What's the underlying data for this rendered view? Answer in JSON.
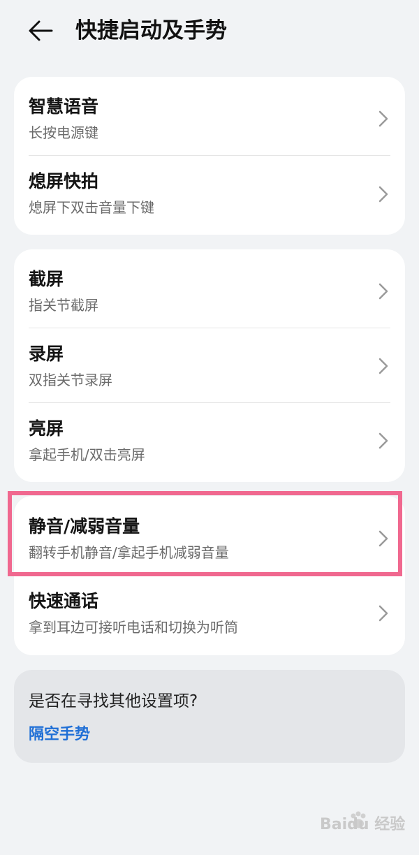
{
  "header": {
    "title": "快捷启动及手势"
  },
  "groups": [
    {
      "items": [
        {
          "title": "智慧语音",
          "subtitle": "长按电源键"
        },
        {
          "title": "熄屏快拍",
          "subtitle": "熄屏下双击音量下键"
        }
      ]
    },
    {
      "items": [
        {
          "title": "截屏",
          "subtitle": "指关节截屏"
        },
        {
          "title": "录屏",
          "subtitle": "双指关节录屏"
        },
        {
          "title": "亮屏",
          "subtitle": "拿起手机/双击亮屏"
        }
      ]
    },
    {
      "items": [
        {
          "title": "静音/减弱音量",
          "subtitle": "翻转手机静音/拿起手机减弱音量"
        },
        {
          "title": "快速通话",
          "subtitle": "拿到耳边可接听电话和切换为听筒"
        }
      ]
    }
  ],
  "suggestion": {
    "question": "是否在寻找其他设置项?",
    "link": "隔空手势"
  },
  "watermark": "Baidu 经验",
  "colors": {
    "highlight": "#f0688f",
    "link": "#1f6fd6",
    "background": "#f1f3f5"
  },
  "icons": {
    "back": "arrow-left-icon",
    "chevron": "chevron-right-icon"
  }
}
